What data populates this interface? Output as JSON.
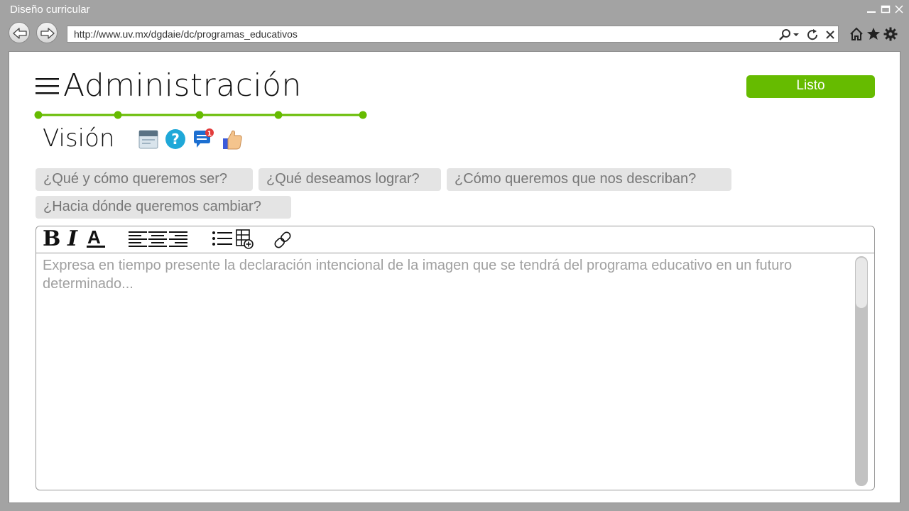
{
  "window": {
    "title": "Diseño curricular"
  },
  "browser": {
    "url": "http://www.uv.mx/dgdaie/dc/programas_educativos"
  },
  "header": {
    "title": "Administración",
    "done_label": "Listo",
    "stepper_steps": 5,
    "accent_color": "#66bb00"
  },
  "section": {
    "title": "Visión",
    "icons": [
      "calendar-icon",
      "help-icon",
      "comments-icon",
      "thumbs-up-icon"
    ],
    "notification_count": "1"
  },
  "prompts": [
    "¿Qué y cómo queremos ser?",
    "¿Qué deseamos lograr?",
    "¿Cómo queremos que nos describan?",
    "¿Hacia dónde queremos cambiar?"
  ],
  "editor": {
    "toolbar": {
      "bold": "B",
      "italic": "I",
      "font_color": "A"
    },
    "placeholder": "Expresa en tiempo presente la declaración intencional de la imagen que se tendrá del programa educativo en un futuro determinado..."
  }
}
